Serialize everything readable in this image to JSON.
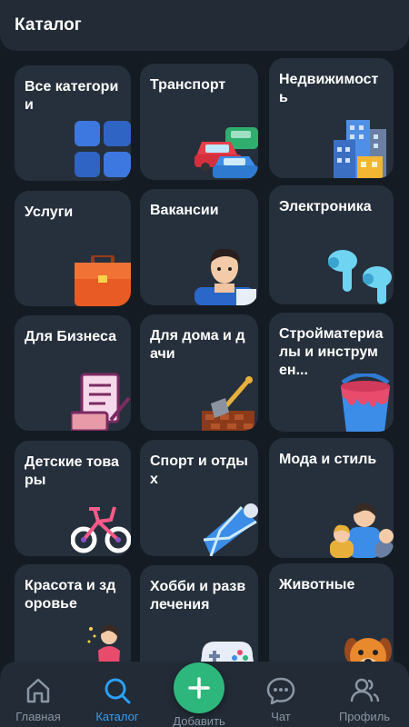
{
  "header": {
    "title": "Каталог"
  },
  "categories": [
    {
      "label": "Все категории",
      "icon": "grid-icon"
    },
    {
      "label": "Транспорт",
      "icon": "cars-icon"
    },
    {
      "label": "Недвижимость",
      "icon": "buildings-icon"
    },
    {
      "label": "Услуги",
      "icon": "briefcase-icon"
    },
    {
      "label": "Вакансии",
      "icon": "worker-icon"
    },
    {
      "label": "Электроника",
      "icon": "earbuds-icon"
    },
    {
      "label": "Для Бизнеса",
      "icon": "business-icon"
    },
    {
      "label": "Для дома и дачи",
      "icon": "shovel-icon"
    },
    {
      "label": "Стройматериалы и инструмен...",
      "icon": "paint-bucket-icon"
    },
    {
      "label": "Детские товары",
      "icon": "bicycle-icon"
    },
    {
      "label": "Спорт и отдых",
      "icon": "shuttlecock-icon"
    },
    {
      "label": "Мода и стиль",
      "icon": "people-icon"
    },
    {
      "label": "Красота и здоровье",
      "icon": "model-icon"
    },
    {
      "label": "Хобби и развлечения",
      "icon": "gamepad-icon"
    },
    {
      "label": "Животные",
      "icon": "dog-icon"
    }
  ],
  "tabs": [
    {
      "label": "Главная",
      "icon": "home-icon",
      "active": false
    },
    {
      "label": "Каталог",
      "icon": "search-icon",
      "active": true
    },
    {
      "label": "Добавить",
      "icon": "plus-icon",
      "active": false
    },
    {
      "label": "Чат",
      "icon": "chat-icon",
      "active": false
    },
    {
      "label": "Профиль",
      "icon": "profile-icon",
      "active": false
    }
  ],
  "colors": {
    "background": "#141b23",
    "tile": "#26303c",
    "accent_active": "#2aa0ff",
    "fab": "#2db77c"
  }
}
